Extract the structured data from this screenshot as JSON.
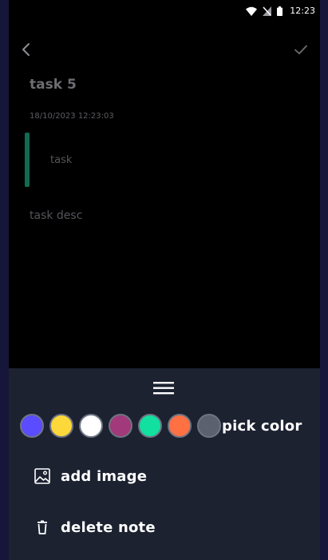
{
  "status_bar": {
    "time": "12:23",
    "icons": [
      "wifi-icon",
      "signal-icon",
      "battery-icon"
    ]
  },
  "toolbar": {
    "back_icon": "chevron-left-icon",
    "done_icon": "check-icon"
  },
  "note": {
    "title": "task 5",
    "datetime": "18/10/2023 12:23:03",
    "subtitle": "task",
    "description": "task desc",
    "accent_color": "#0f6b52"
  },
  "bottom_sheet": {
    "handle_icon": "menu-icon",
    "colors": [
      "#5b4cff",
      "#fdd83a",
      "#ffffff",
      "#a1397a",
      "#12e0a0",
      "#ff7143",
      "#5c616f"
    ],
    "pick_color_label": "pick color",
    "add_image_label": "add image",
    "delete_note_label": "delete note"
  }
}
